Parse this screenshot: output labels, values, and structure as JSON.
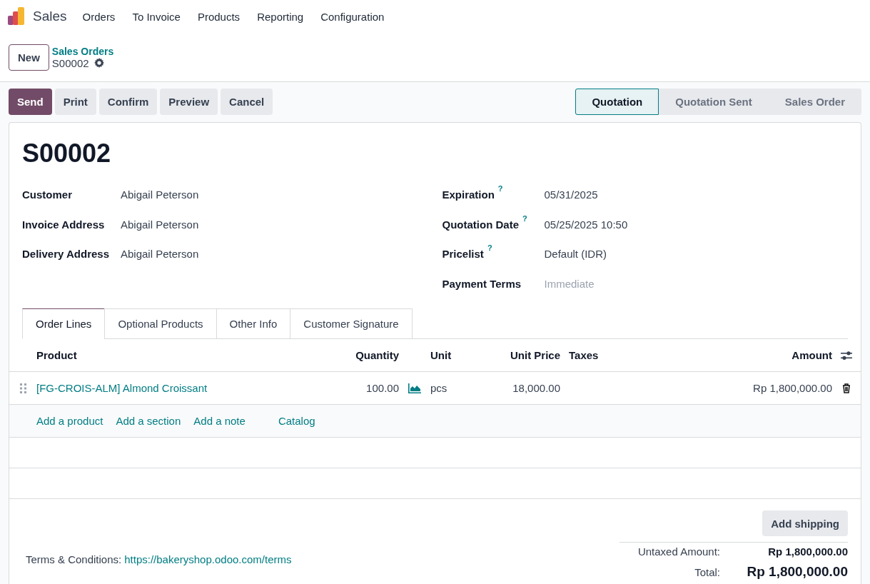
{
  "app": {
    "name": "Sales"
  },
  "menu": [
    "Orders",
    "To Invoice",
    "Products",
    "Reporting",
    "Configuration"
  ],
  "new_button": "New",
  "breadcrumb": {
    "parent": "Sales Orders",
    "current": "S00002"
  },
  "actions": [
    {
      "label": "Send",
      "primary": true
    },
    {
      "label": "Print",
      "primary": false
    },
    {
      "label": "Confirm",
      "primary": false
    },
    {
      "label": "Preview",
      "primary": false
    },
    {
      "label": "Cancel",
      "primary": false
    }
  ],
  "stages": [
    {
      "label": "Quotation",
      "selected": true
    },
    {
      "label": "Quotation Sent",
      "selected": false
    },
    {
      "label": "Sales Order",
      "selected": false
    }
  ],
  "title": "S00002",
  "fields_left": [
    {
      "label": "Customer",
      "value": "Abigail Peterson"
    },
    {
      "label": "Invoice Address",
      "value": "Abigail Peterson"
    },
    {
      "label": "Delivery Address",
      "value": "Abigail Peterson"
    }
  ],
  "fields_right": [
    {
      "label": "Expiration",
      "help": "?",
      "value": "05/31/2025"
    },
    {
      "label": "Quotation Date",
      "help": "?",
      "value": "05/25/2025 10:50"
    },
    {
      "label": "Pricelist",
      "help": "?",
      "value": "Default (IDR)"
    },
    {
      "label": "Payment Terms",
      "placeholder": "Immediate"
    }
  ],
  "tabs": [
    {
      "label": "Order Lines",
      "selected": true
    },
    {
      "label": "Optional Products",
      "selected": false
    },
    {
      "label": "Other Info",
      "selected": false
    },
    {
      "label": "Customer Signature",
      "selected": false
    }
  ],
  "table": {
    "columns": [
      "Product",
      "Quantity",
      "Unit",
      "Unit Price",
      "Taxes",
      "Amount"
    ],
    "rows": [
      {
        "product": "[FG-CROIS-ALM] Almond Croissant",
        "quantity": "100.00",
        "unit": "pcs",
        "unit_price": "18,000.00",
        "taxes": "",
        "amount": "Rp 1,800,000.00"
      }
    ]
  },
  "add_links": [
    "Add a product",
    "Add a section",
    "Add a note"
  ],
  "catalog": "Catalog",
  "add_shipping": "Add shipping",
  "terms": {
    "label": "Terms & Conditions:",
    "link": "https://bakeryshop.odoo.com/terms"
  },
  "totals": [
    {
      "label": "Untaxed Amount:",
      "value": "Rp 1,800,000.00",
      "grand": false
    },
    {
      "label": "Total:",
      "value": "Rp 1,800,000.00",
      "grand": true
    }
  ]
}
